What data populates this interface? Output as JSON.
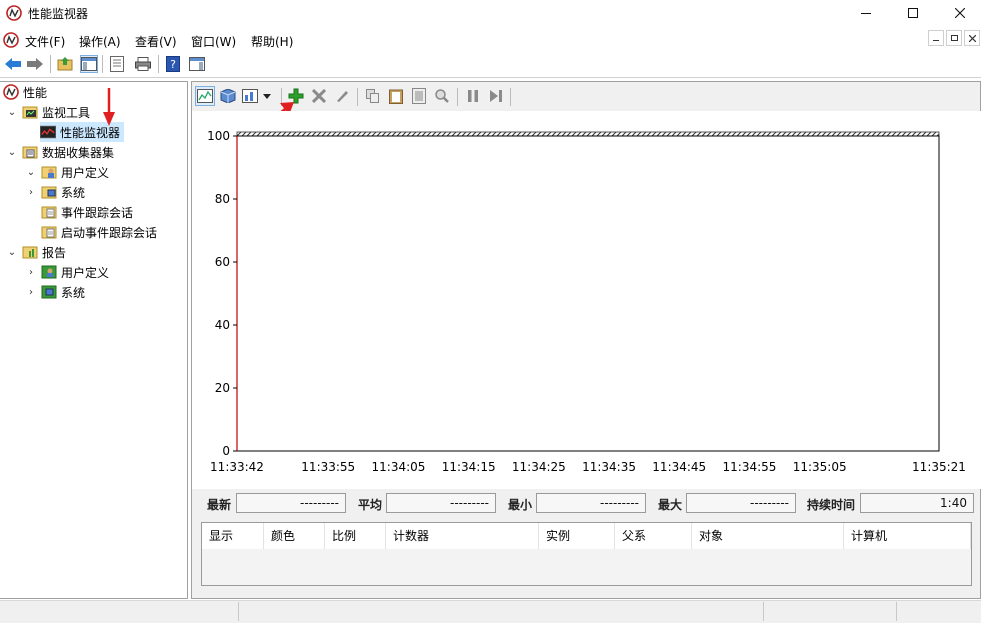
{
  "window": {
    "title": "性能监视器"
  },
  "menubar": {
    "items": [
      "文件(F)",
      "操作(A)",
      "查看(V)",
      "窗口(W)",
      "帮助(H)"
    ]
  },
  "tree": {
    "root": "性能",
    "monitor_tools": "监视工具",
    "perf_monitor": "性能监视器",
    "data_collector_sets": "数据收集器集",
    "dcs_user_defined": "用户定义",
    "dcs_system": "系统",
    "event_trace_sessions": "事件跟踪会话",
    "startup_event_trace_sessions": "启动事件跟踪会话",
    "reports": "报告",
    "reports_user_defined": "用户定义",
    "reports_system": "系统"
  },
  "chart_data": {
    "type": "line",
    "yticks": [
      "100",
      "80",
      "60",
      "40",
      "20",
      "0"
    ],
    "ylim": [
      0,
      100
    ],
    "x_tick_labels": [
      "11:33:42",
      "11:33:55",
      "11:34:05",
      "11:34:15",
      "11:34:25",
      "11:34:35",
      "11:34:45",
      "11:34:55",
      "11:35:05",
      "11:35:21"
    ],
    "series": []
  },
  "stats": {
    "latest_label": "最新",
    "latest_value": "---------",
    "average_label": "平均",
    "average_value": "---------",
    "minimum_label": "最小",
    "minimum_value": "---------",
    "maximum_label": "最大",
    "maximum_value": "---------",
    "duration_label": "持续时间",
    "duration_value": "1:40"
  },
  "counter_table": {
    "columns": [
      "显示",
      "颜色",
      "比例",
      "计数器",
      "实例",
      "父系",
      "对象",
      "计算机"
    ]
  },
  "colors": {
    "accent_red": "#e02020",
    "add_green": "#2aa02a",
    "selection": "#cce8ff",
    "chart_axis_red": "#c00000"
  }
}
